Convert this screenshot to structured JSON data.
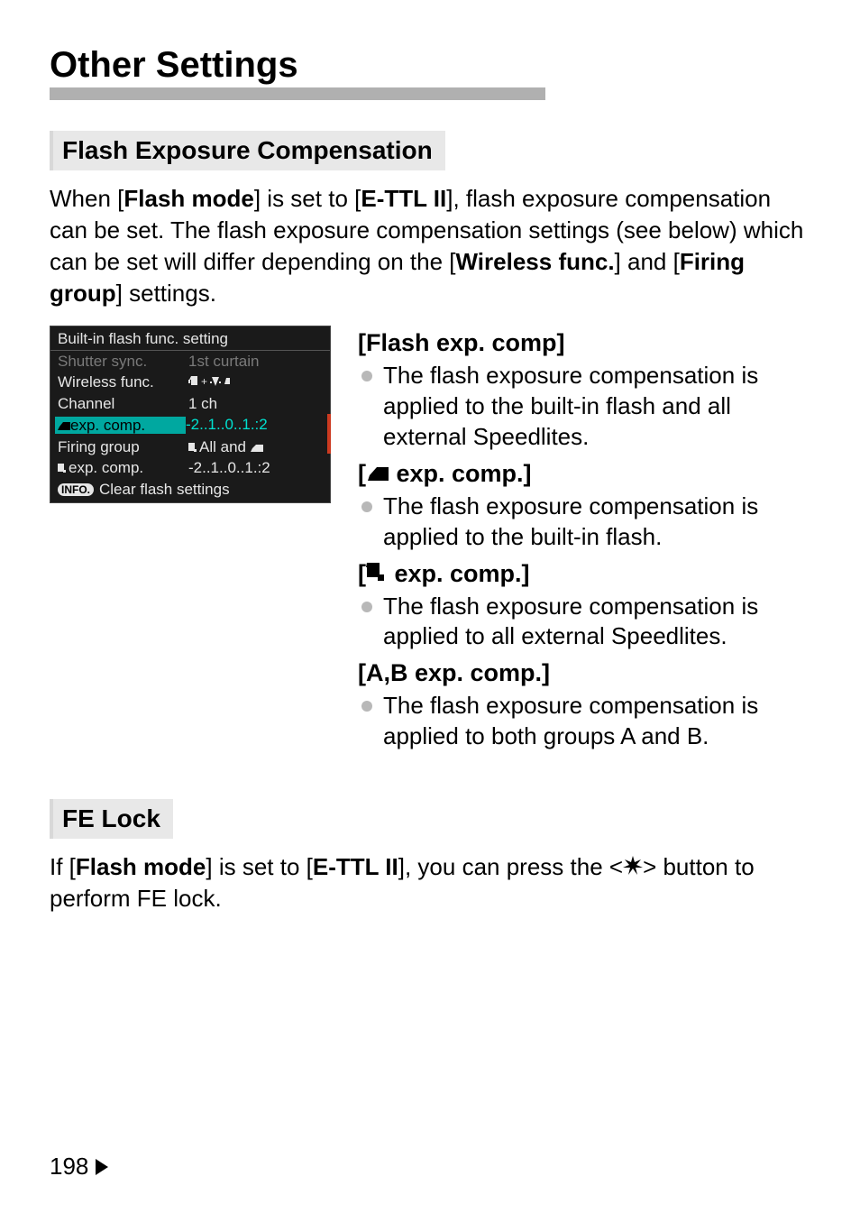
{
  "title": "Other Settings",
  "section1": {
    "header": "Flash Exposure Compensation",
    "intro_pre": "When [",
    "intro_b1": "Flash mode",
    "intro_mid1": "] is set to [",
    "intro_b2": "E-TTL II",
    "intro_mid2": "], flash exposure compensation can be set. The flash exposure compensation settings (see below) which can be set will differ depending on the [",
    "intro_b3": "Wireless func.",
    "intro_mid3": "] and [",
    "intro_b4": "Firing group",
    "intro_end": "] settings."
  },
  "lcd": {
    "title": "Built-in flash func. setting",
    "rows": [
      {
        "label": "Shutter sync.",
        "val": "1st curtain",
        "dim": true
      },
      {
        "label": "Wireless func.",
        "val_icon": "wireless-combo-icon"
      },
      {
        "label": "Channel",
        "val": "1  ch"
      },
      {
        "label_icon": "builtin-flash-icon",
        "label": "exp. comp.",
        "val": "-2..1..0..1.:2",
        "highlight": true
      },
      {
        "label": "Firing group",
        "val_icon": "all-and-icon",
        "val_text": "All and"
      },
      {
        "label_icon": "speedlite-icon",
        "label": "exp. comp.",
        "val": "-2..1..0..1.:2"
      }
    ],
    "footer_badge": "INFO.",
    "footer_text": "Clear flash settings"
  },
  "right": {
    "h1": "[Flash exp. comp]",
    "b1": "The flash exposure compensation is applied to the built-in flash and all external Speedlites.",
    "h2_pre": "[",
    "h2_post": " exp. comp.]",
    "b2": "The flash exposure compensation is applied to the built-in flash.",
    "h3_pre": "[",
    "h3_post": " exp. comp.]",
    "b3": "The flash exposure compensation is applied to all external Speedlites.",
    "h4": "[A,B exp. comp.]",
    "b4": "The flash exposure compensation is applied to both groups A and B."
  },
  "section2": {
    "header": "FE Lock",
    "p_pre": "If [",
    "p_b1": "Flash mode",
    "p_mid1": "] is set to [",
    "p_b2": "E-TTL II",
    "p_mid2": "], you can press the <",
    "p_mid3": "> button to perform FE lock."
  },
  "page_number": "198"
}
